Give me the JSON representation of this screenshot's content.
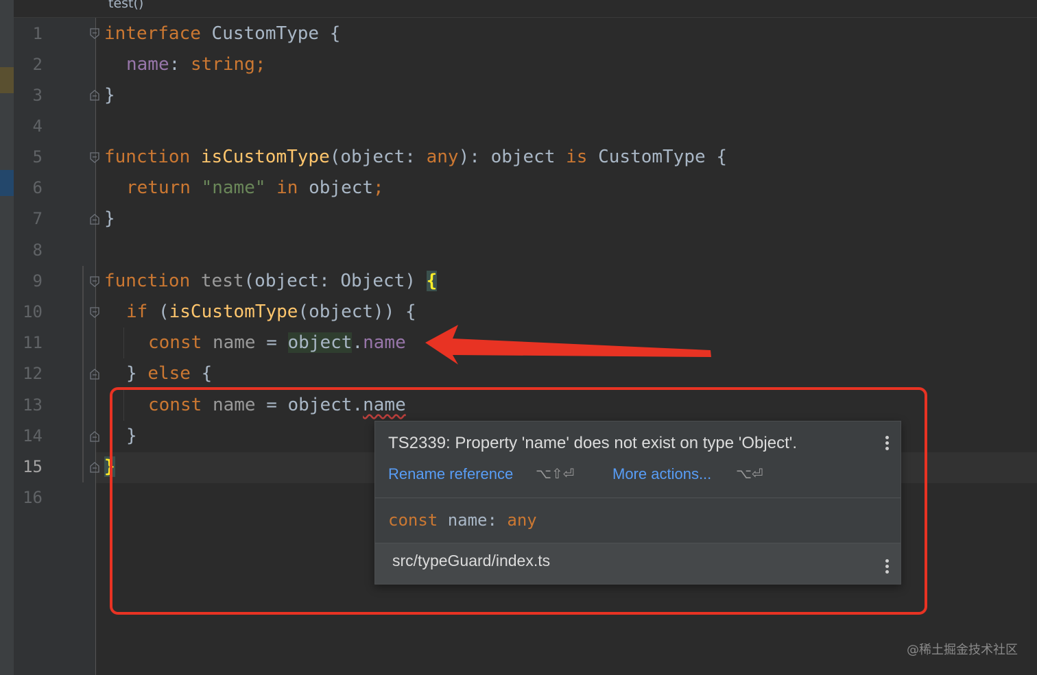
{
  "breadcrumb": "test()",
  "line_numbers": [
    "1",
    "2",
    "3",
    "4",
    "5",
    "6",
    "7",
    "8",
    "9",
    "10",
    "11",
    "12",
    "13",
    "14",
    "15",
    "16"
  ],
  "current_line": "15",
  "code": {
    "l1": {
      "kw": "interface",
      "name": "CustomType",
      "brace": "{"
    },
    "l2": {
      "prop": "name",
      "colon": ":",
      "type": "string",
      "semi": ";"
    },
    "l3": {
      "brace": "}"
    },
    "l5": {
      "kw": "function",
      "fn": "isCustomType",
      "open": "(object:",
      "type": "any",
      "close": "):",
      "ret": "object",
      "is": "is",
      "rtype": "CustomType",
      "brace": "{"
    },
    "l6": {
      "kw": "return",
      "str": "\"name\"",
      "in": "in",
      "obj": "object",
      "semi": ";"
    },
    "l7": {
      "brace": "}"
    },
    "l9": {
      "kw": "function",
      "fn": "test",
      "params": "(object: Object)",
      "brace": "{"
    },
    "l10": {
      "kw": "if",
      "open": "(",
      "fn": "isCustomType",
      "rest": "(object)) {"
    },
    "l11": {
      "kw": "const",
      "var": "name",
      "eq": "=",
      "obj": "object",
      "dot": ".",
      "prop": "name"
    },
    "l12": {
      "close": "}",
      "kw": "else",
      "brace": "{"
    },
    "l13": {
      "kw": "const",
      "var": "name",
      "eq": "=",
      "obj": "object",
      "dot": ".",
      "prop": "name"
    },
    "l14": {
      "brace": "}"
    },
    "l15": {
      "brace": "}"
    }
  },
  "tooltip": {
    "error": "TS2339: Property 'name' does not exist on type 'Object'.",
    "rename_label": "Rename reference",
    "rename_shortcut": "⌥⇧⏎",
    "more_label": "More actions...",
    "more_shortcut": "⌥⏎",
    "sig_kw": "const",
    "sig_name": "name:",
    "sig_type": "any",
    "file": "src/typeGuard/index.ts"
  },
  "watermark": "@稀土掘金技术社区",
  "colors": {
    "keyword": "#cc7832",
    "function": "#ffc66d",
    "property": "#9876aa",
    "string": "#6a8759",
    "link": "#589df6",
    "annotation_red": "#e83323"
  }
}
